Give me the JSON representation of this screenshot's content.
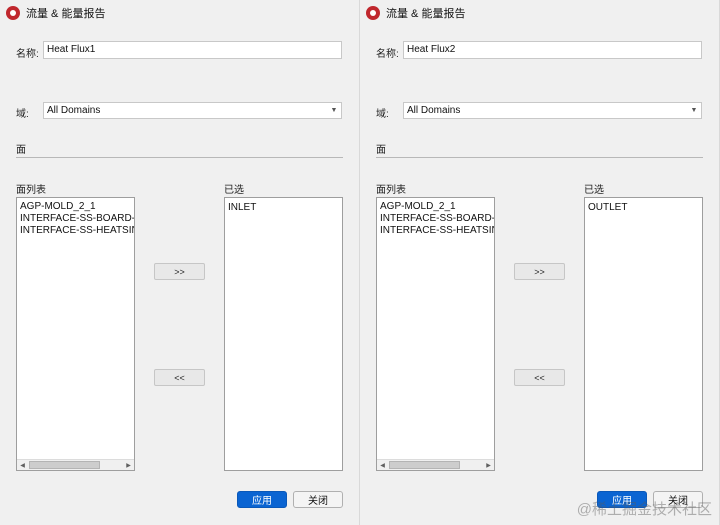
{
  "dialogs": [
    {
      "title": "流量 & 能量报告",
      "name_label": "名称:",
      "name_value": "Heat Flux1",
      "domain_label": "域:",
      "domain_value": "All Domains",
      "section_label": "面",
      "face_list_label": "面列表",
      "selected_label": "已选",
      "face_list": [
        "AGP-MOLD_2_1",
        "INTERFACE-SS-BOARD-",
        "INTERFACE-SS-HEATSIN"
      ],
      "selected_list": [
        "INLET"
      ],
      "add_label": ">>",
      "remove_label": "<<",
      "apply_label": "应用",
      "close_label": "关闭"
    },
    {
      "title": "流量 & 能量报告",
      "name_label": "名称:",
      "name_value": "Heat Flux2",
      "domain_label": "域:",
      "domain_value": "All Domains",
      "section_label": "面",
      "face_list_label": "面列表",
      "selected_label": "已选",
      "face_list": [
        "AGP-MOLD_2_1",
        "INTERFACE-SS-BOARD-",
        "INTERFACE-SS-HEATSIN"
      ],
      "selected_list": [
        "OUTLET"
      ],
      "add_label": ">>",
      "remove_label": "<<",
      "apply_label": "应用",
      "close_label": "关闭"
    }
  ],
  "watermark": "@稀土掘金技术社区",
  "colors": {
    "primary_button": "#0a64d2",
    "app_icon": "#c0272d"
  },
  "icons": {
    "app": "app-logo-icon",
    "dropdown": "chevron-down-icon",
    "scroll_left": "arrow-left-icon",
    "scroll_right": "arrow-right-icon"
  }
}
